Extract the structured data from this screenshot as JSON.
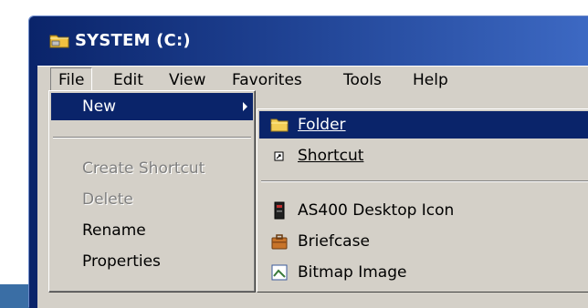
{
  "window": {
    "title": "SYSTEM (C:)",
    "title_icon": "folder-icon"
  },
  "menubar": {
    "items": [
      "File",
      "Edit",
      "View",
      "Favorites",
      "Tools",
      "Help"
    ]
  },
  "file_menu": {
    "new_label": "New",
    "create_shortcut_label": "Create Shortcut",
    "delete_label": "Delete",
    "rename_label": "Rename",
    "properties_label": "Properties"
  },
  "new_submenu": {
    "folder_label": "Folder",
    "shortcut_label": "Shortcut",
    "as400_label": "AS400 Desktop Icon",
    "briefcase_label": "Briefcase",
    "bitmap_label": "Bitmap Image"
  },
  "colors": {
    "highlight": "#0a246a",
    "menu_bg": "#d4d0c8",
    "disabled_text": "#808080"
  }
}
